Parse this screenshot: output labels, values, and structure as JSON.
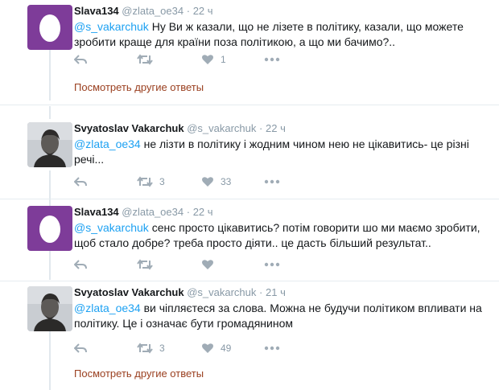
{
  "tweets": [
    {
      "name": "Slava134",
      "handle": "@zlata_oe34",
      "dot": "·",
      "time": "22 ч",
      "avatar": "egg-avatar",
      "mention": "@s_vakarchuk",
      "body": " Ну Ви ж казали, що не лізете в політику, казали, що можете зробити краще для країни поза політикою, а що ми бачимо?..",
      "retweets": "",
      "likes": "1",
      "more_link": "Посмотреть другие ответы"
    },
    {
      "name": "Svyatoslav Vakarchuk",
      "handle": "@s_vakarchuk",
      "dot": "·",
      "time": "22 ч",
      "avatar": "photo-avatar",
      "mention": "@zlata_oe34",
      "body": " не лізти в політику і жодним чином нею не цікавитись- це різні речі...",
      "retweets": "3",
      "likes": "33"
    },
    {
      "name": "Slava134",
      "handle": "@zlata_oe34",
      "dot": "·",
      "time": "22 ч",
      "avatar": "egg-avatar",
      "mention": "@s_vakarchuk",
      "body": " сенс просто цікавитись? потім говорити шо ми маємо зробити, щоб стало добре? треба просто діяти.. це дасть більший результат..",
      "retweets": "",
      "likes": ""
    },
    {
      "name": "Svyatoslav Vakarchuk",
      "handle": "@s_vakarchuk",
      "dot": "·",
      "time": "21 ч",
      "avatar": "photo-avatar",
      "mention": "@zlata_oe34",
      "body": " ви чіпляєтеся за слова. Можна не будучи політиком впливати на політику. Це і означає бути громадянином",
      "retweets": "3",
      "likes": "49",
      "more_link": "Посмотреть другие ответы"
    }
  ],
  "colors": {
    "accent": "#1da1f2",
    "egg_bg": "#7e3c99",
    "link": "#9a3f1f",
    "muted": "#8899a6"
  }
}
